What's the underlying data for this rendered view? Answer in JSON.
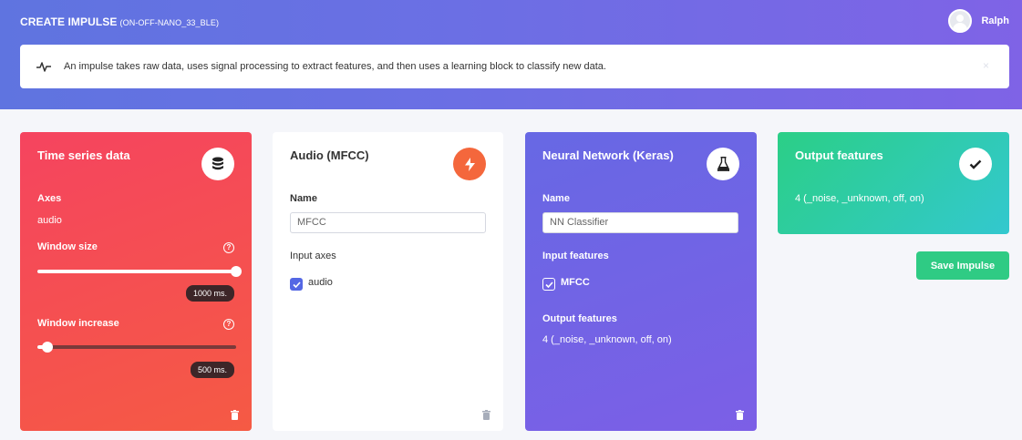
{
  "header": {
    "title": "CREATE IMPULSE",
    "project": "(ON-OFF-NANO_33_BLE)",
    "user_name": "Ralph"
  },
  "info": {
    "text": "An impulse takes raw data, uses signal processing to extract features, and then uses a learning block to classify new data.",
    "close": "×"
  },
  "input_block": {
    "title": "Time series data",
    "icon": "database-icon",
    "axes_label": "Axes",
    "axes_value": "audio",
    "window_size_label": "Window size",
    "window_size_value": "1000 ms.",
    "window_size_fraction": 1.0,
    "window_increase_label": "Window increase",
    "window_increase_value": "500 ms.",
    "window_increase_fraction": 0.05,
    "help": "?"
  },
  "processing_block": {
    "title": "Audio (MFCC)",
    "icon": "lightning-icon",
    "name_label": "Name",
    "name_value": "MFCC",
    "input_axes_label": "Input axes",
    "axis": "audio"
  },
  "learning_block": {
    "title": "Neural Network (Keras)",
    "icon": "flask-icon",
    "name_label": "Name",
    "name_value": "NN Classifier",
    "input_features_label": "Input features",
    "input_feature": "MFCC",
    "output_features_label": "Output features",
    "output_features_value": "4 (_noise, _unknown, off, on)"
  },
  "output_block": {
    "title": "Output features",
    "icon": "check-icon",
    "value": "4 (_noise, _unknown, off, on)"
  },
  "actions": {
    "save_label": "Save Impulse"
  },
  "colors": {
    "header_start": "#5f74e0",
    "header_end": "#7f63e6",
    "input_card": "#f5445f",
    "learning_card": "#6b66e4",
    "output_card": "#2bcf86",
    "save_button": "#2fcb84",
    "checkbox_blue": "#5467e4"
  }
}
